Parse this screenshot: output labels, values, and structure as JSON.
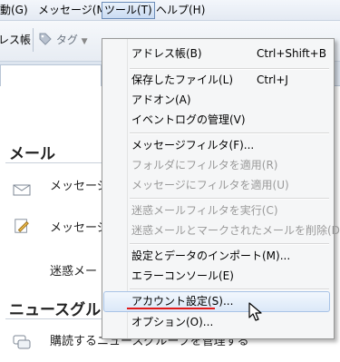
{
  "menubar": {
    "items": [
      "動(G)",
      "メッセージ(M)",
      "ツール(T)",
      "ヘルプ(H)"
    ]
  },
  "toolbar": {
    "address_book": "レス帳",
    "tag": "タグ"
  },
  "content": {
    "mail_header": "メール",
    "rows": [
      "メッセージ",
      "メッセージ",
      "迷惑メー"
    ],
    "news_header": "ニュースグル",
    "news_row": "購読するニュースグループを管理する"
  },
  "menu": {
    "items": [
      {
        "label": "アドレス帳(B)",
        "accel": "Ctrl+Shift+B",
        "enabled": true
      },
      {
        "label": "保存したファイル(L)",
        "accel": "Ctrl+J",
        "enabled": true
      },
      {
        "label": "アドオン(A)",
        "accel": "",
        "enabled": true
      },
      {
        "label": "イベントログの管理(V)",
        "accel": "",
        "enabled": true
      },
      {
        "label": "メッセージフィルタ(F)...",
        "accel": "",
        "enabled": true
      },
      {
        "label": "フォルダにフィルタを適用(R)",
        "accel": "",
        "enabled": false
      },
      {
        "label": "メッセージにフィルタを適用(U)",
        "accel": "",
        "enabled": false
      },
      {
        "label": "迷惑メールフィルタを実行(C)",
        "accel": "",
        "enabled": false
      },
      {
        "label": "迷惑メールとマークされたメールを削除(D)",
        "accel": "",
        "enabled": false
      },
      {
        "label": "設定とデータのインポート(M)...",
        "accel": "",
        "enabled": true
      },
      {
        "label": "エラーコンソール(E)",
        "accel": "",
        "enabled": true
      },
      {
        "label": "アカウント設定(S)...",
        "accel": "",
        "enabled": true,
        "highlighted": true
      },
      {
        "label": "オプション(O)...",
        "accel": "",
        "enabled": true
      }
    ]
  }
}
